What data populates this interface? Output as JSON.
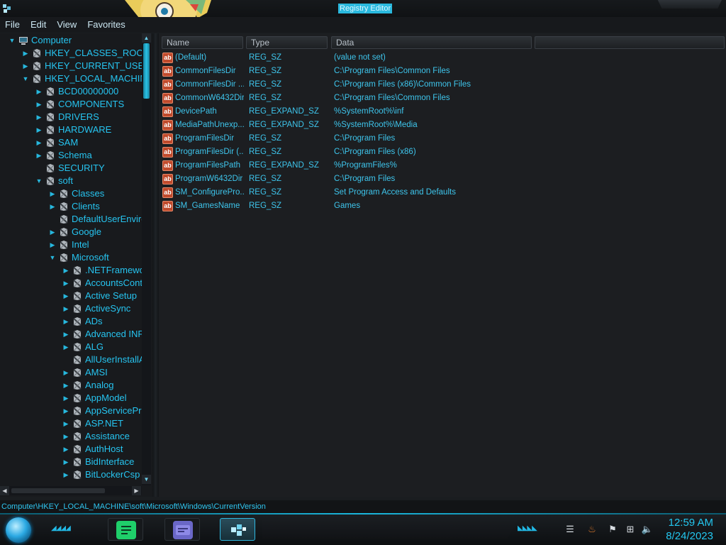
{
  "window": {
    "title": "Registry Editor",
    "icon": "registry-editor-icon"
  },
  "menu": [
    "File",
    "Edit",
    "View",
    "Favorites"
  ],
  "tree": [
    {
      "label": "Computer",
      "level": 0,
      "expanded": true,
      "icon": "computer-icon"
    },
    {
      "label": "HKEY_CLASSES_ROOT",
      "level": 1,
      "expanded": false
    },
    {
      "label": "HKEY_CURRENT_USER",
      "level": 1,
      "expanded": false
    },
    {
      "label": "HKEY_LOCAL_MACHINE",
      "level": 1,
      "expanded": true
    },
    {
      "label": "BCD00000000",
      "level": 2,
      "expanded": false
    },
    {
      "label": "COMPONENTS",
      "level": 2,
      "expanded": false
    },
    {
      "label": "DRIVERS",
      "level": 2,
      "expanded": false
    },
    {
      "label": "HARDWARE",
      "level": 2,
      "expanded": false
    },
    {
      "label": "SAM",
      "level": 2,
      "expanded": false
    },
    {
      "label": "Schema",
      "level": 2,
      "expanded": false
    },
    {
      "label": "SECURITY",
      "level": 2,
      "expanded": null
    },
    {
      "label": "soft",
      "level": 2,
      "expanded": true
    },
    {
      "label": "Classes",
      "level": 3,
      "expanded": false
    },
    {
      "label": "Clients",
      "level": 3,
      "expanded": false
    },
    {
      "label": "DefaultUserEnvironment",
      "level": 3,
      "expanded": null
    },
    {
      "label": "Google",
      "level": 3,
      "expanded": false
    },
    {
      "label": "Intel",
      "level": 3,
      "expanded": false
    },
    {
      "label": "Microsoft",
      "level": 3,
      "expanded": true
    },
    {
      "label": ".NETFramework",
      "level": 4,
      "expanded": false
    },
    {
      "label": "AccountsControl",
      "level": 4,
      "expanded": false
    },
    {
      "label": "Active Setup",
      "level": 4,
      "expanded": false
    },
    {
      "label": "ActiveSync",
      "level": 4,
      "expanded": false
    },
    {
      "label": "ADs",
      "level": 4,
      "expanded": false
    },
    {
      "label": "Advanced INF Setup",
      "level": 4,
      "expanded": false
    },
    {
      "label": "ALG",
      "level": 4,
      "expanded": false
    },
    {
      "label": "AllUserInstallAgent",
      "level": 4,
      "expanded": null
    },
    {
      "label": "AMSI",
      "level": 4,
      "expanded": false
    },
    {
      "label": "Analog",
      "level": 4,
      "expanded": false
    },
    {
      "label": "AppModel",
      "level": 4,
      "expanded": false
    },
    {
      "label": "AppServiceProtocols",
      "level": 4,
      "expanded": false
    },
    {
      "label": "ASP.NET",
      "level": 4,
      "expanded": false
    },
    {
      "label": "Assistance",
      "level": 4,
      "expanded": false
    },
    {
      "label": "AuthHost",
      "level": 4,
      "expanded": false
    },
    {
      "label": "BidInterface",
      "level": 4,
      "expanded": false
    },
    {
      "label": "BitLockerCsp",
      "level": 4,
      "expanded": false
    }
  ],
  "columns": {
    "name": "Name",
    "type": "Type",
    "data": "Data"
  },
  "values": [
    {
      "name": "(Default)",
      "type": "REG_SZ",
      "data": "(value not set)"
    },
    {
      "name": "CommonFilesDir",
      "type": "REG_SZ",
      "data": "C:\\Program Files\\Common Files"
    },
    {
      "name": "CommonFilesDir ...",
      "type": "REG_SZ",
      "data": "C:\\Program Files (x86)\\Common Files"
    },
    {
      "name": "CommonW6432Dir",
      "type": "REG_SZ",
      "data": "C:\\Program Files\\Common Files"
    },
    {
      "name": "DevicePath",
      "type": "REG_EXPAND_SZ",
      "data": "%SystemRoot%\\inf"
    },
    {
      "name": "MediaPathUnexp...",
      "type": "REG_EXPAND_SZ",
      "data": "%SystemRoot%\\Media"
    },
    {
      "name": "ProgramFilesDir",
      "type": "REG_SZ",
      "data": "C:\\Program Files"
    },
    {
      "name": "ProgramFilesDir (...",
      "type": "REG_SZ",
      "data": "C:\\Program Files (x86)"
    },
    {
      "name": "ProgramFilesPath",
      "type": "REG_EXPAND_SZ",
      "data": "%ProgramFiles%"
    },
    {
      "name": "ProgramW6432Dir",
      "type": "REG_SZ",
      "data": "C:\\Program Files"
    },
    {
      "name": "SM_ConfigurePro...",
      "type": "REG_SZ",
      "data": "Set Program Access and Defaults"
    },
    {
      "name": "SM_GamesName",
      "type": "REG_SZ",
      "data": "Games"
    }
  ],
  "value_icon_text": "ab",
  "status": {
    "path": "Computer\\HKEY_LOCAL_MACHINE\\soft\\Microsoft\\Windows\\CurrentVersion"
  },
  "taskbar": {
    "apps": [
      {
        "name": "notes-app",
        "icon": "notes-icon",
        "color": "#1fcf6a"
      },
      {
        "name": "id-card-app",
        "icon": "id-card-icon",
        "color": "#6a67c7"
      },
      {
        "name": "registry-editor",
        "icon": "registry-cubes-icon",
        "color": "#2fb8e0"
      }
    ],
    "tray_icons": [
      "java-icon",
      "flag-icon",
      "network-icon",
      "volume-icon"
    ],
    "time": "12:59 AM",
    "date": "8/24/2023"
  },
  "colors": {
    "accent": "#26c4f0",
    "background": "#1a1d20",
    "title_highlight": "#2ab9de"
  }
}
